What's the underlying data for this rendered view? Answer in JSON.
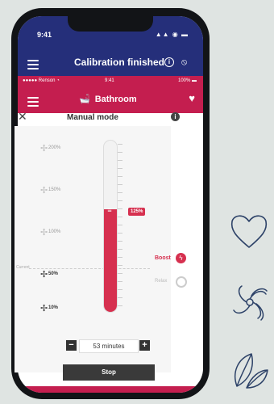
{
  "os": {
    "time": "9:41",
    "icons": "▲▲ ◉ ▬"
  },
  "outer_bar": {
    "title": "Calibration finished",
    "info_glyph": "i"
  },
  "inner_bar": {
    "carrier": "●●●●● Renson ◔",
    "time": "9:41",
    "battery": "100% ▬",
    "title": "Bathroom",
    "bath_icon": "bath-icon"
  },
  "manual": {
    "title": "Manual mode",
    "close_glyph": "✕",
    "info_glyph": "i"
  },
  "levels": [
    {
      "label": "200%",
      "dark": false
    },
    {
      "label": "150%",
      "dark": false
    },
    {
      "label": "100%",
      "dark": false
    },
    {
      "label": "50%",
      "dark": true
    },
    {
      "label": "10%",
      "dark": true
    }
  ],
  "current_label": "Current",
  "slider": {
    "value_label": "125%",
    "fill_fraction": 0.6
  },
  "modes": {
    "boost": "Boost",
    "relax": "Relax"
  },
  "timer": {
    "value": "53 minutes",
    "minus": "−",
    "plus": "+"
  },
  "stop_label": "Stop",
  "colors": {
    "accent": "#d6304f",
    "outer_bar": "#252f7a",
    "inner_bar": "#c41e4f",
    "deco": "#2d4268"
  }
}
